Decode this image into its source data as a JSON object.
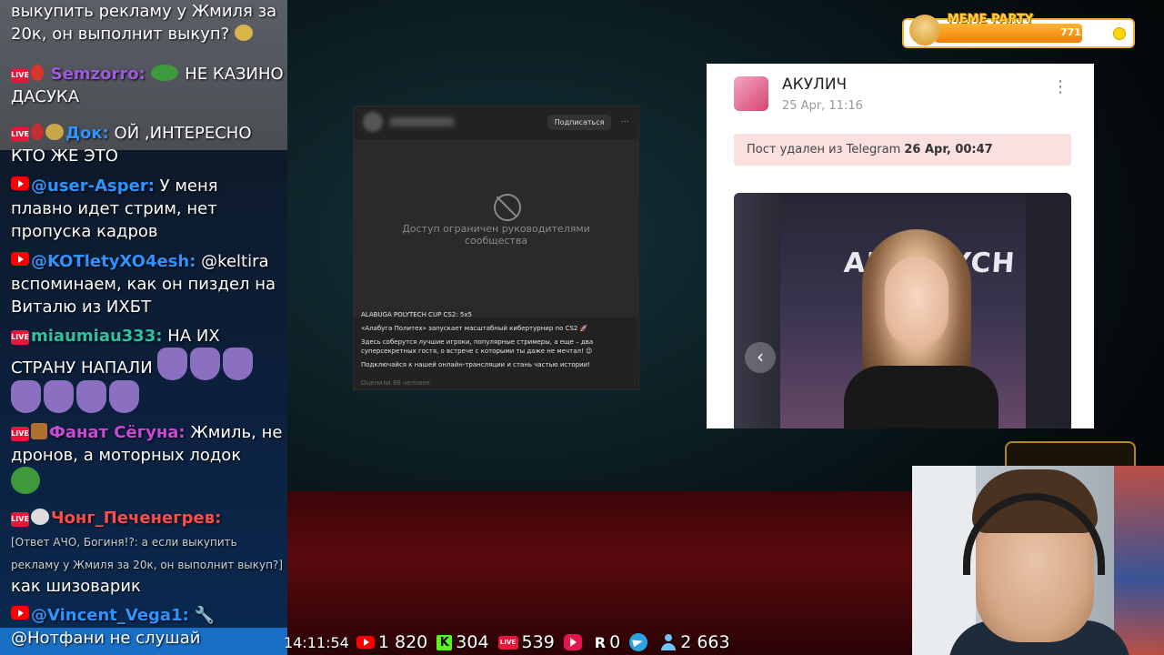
{
  "chat": {
    "messages": [
      {
        "text_lines": [
          "выкупить рекламу у Жмиля за",
          "20к, он выполнит выкуп?"
        ]
      },
      {
        "platform": "LIVE",
        "user": "Semzorro:",
        "text": "НЕ КАЗИНО ДАСУКА"
      },
      {
        "platform": "LIVE",
        "user": "Док:",
        "text": "ОЙ ,ИНТЕРЕСНО КТО ЖЕ ЭТО"
      },
      {
        "platform": "youtube",
        "user": "@user-Asper:",
        "text": "У меня плавно идет стрим, нет пропуска кадров"
      },
      {
        "platform": "youtube",
        "user": "@KOTletyXO4esh:",
        "text": "@keltira вспоминаем, как он пиздел на Виталю из ИХБТ"
      },
      {
        "platform": "LIVE",
        "user": "miaumiau333:",
        "text": "НА ИХ СТРАНУ НАПАЛИ"
      },
      {
        "platform": "LIVE",
        "user": "Фанат Сёгуна:",
        "text": "Жмиль, не дронов, а моторных лодок"
      },
      {
        "platform": "LIVE",
        "user": "Чонг_Печенегрев:",
        "reply": "[Ответ АЧО, Богиня!?: а если выкупить рекламу у Жмиля за 20к, он выполнит выкуп?]",
        "text": "как шизоварик"
      },
      {
        "platform": "youtube",
        "user": "@Vincent_Vega1:",
        "text": "@Нотфани не слушай"
      }
    ],
    "live_badge": "LIVE"
  },
  "vk_card": {
    "subscribe_label": "Подписаться",
    "menu_label": "···",
    "restricted_text": "Доступ ограничен руководителями сообщества",
    "post_title": "ALABUGA POLYTECH CUP CS2: 5x5",
    "post_p1": "«Алабуга Политех» запускает масштабный кибертурнир по CS2 🚀",
    "post_p2": "Здесь соберутся лучшие игроки, популярные стримеры, а еще – два суперсекретных гостя, о встрече с которыми ты даже не мечтал! 😉",
    "post_p3": "Подключайся к нашей онлайн-трансляции и стань частью истории!",
    "footer": "Оценили 86 человек"
  },
  "tg_card": {
    "channel_name": "АКУЛИЧ",
    "date": "25 Apr, 11:16",
    "deleted_text": "Пост удален из Telegram",
    "deleted_date": "26 Apr, 00:47",
    "photo_sign": "ALABUYCH",
    "prev_arrow": "‹"
  },
  "meme_party": {
    "title": "MEME PARTY",
    "count": "771 / 1000",
    "progress": 0.771
  },
  "status_bar": {
    "time": "14:11:54",
    "youtube_viewers": "1 820",
    "kick_viewers": "304",
    "kick_icon": "K",
    "live_viewers": "539",
    "live_icon": "LIVE",
    "rutube_icon": "R",
    "rutube_viewers": "0",
    "total_viewers": "2 663"
  }
}
